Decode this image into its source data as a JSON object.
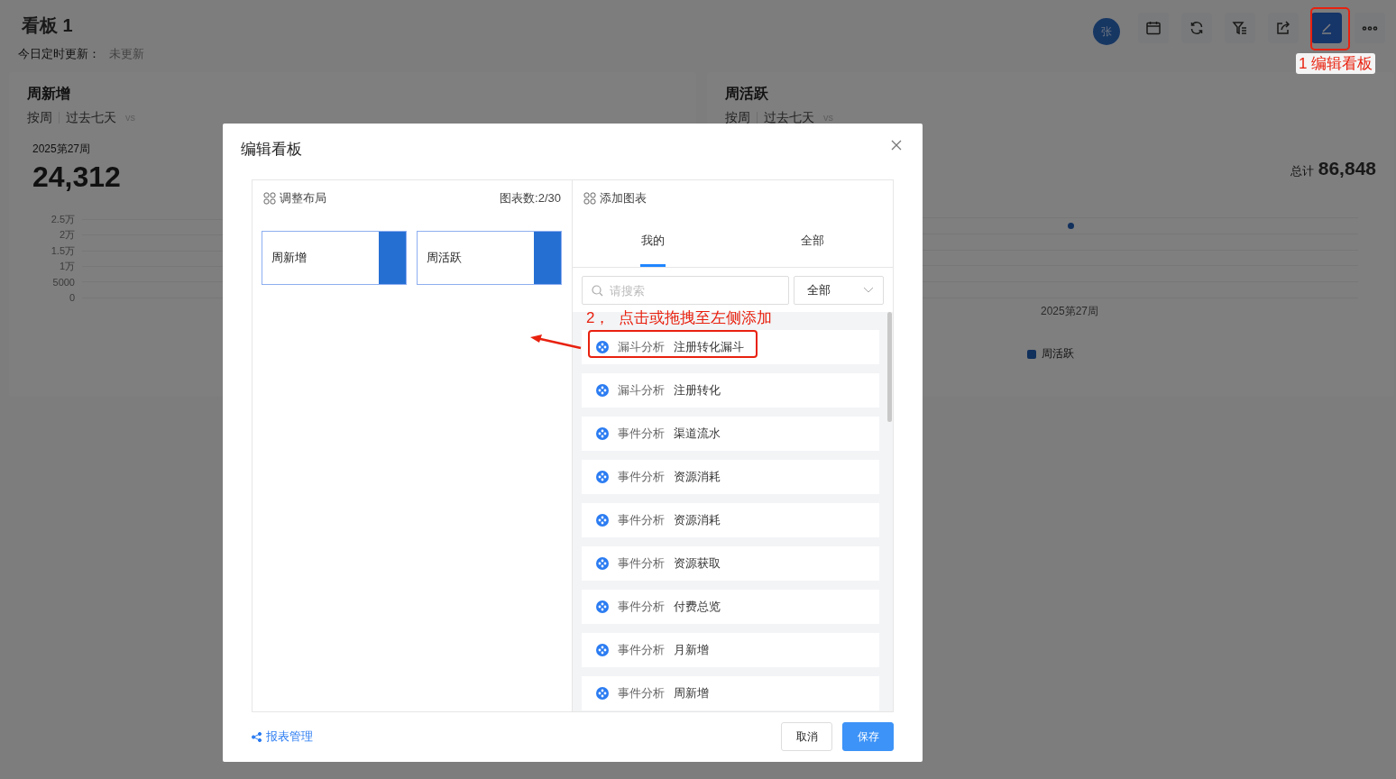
{
  "header": {
    "title": "看板 1",
    "update_label": "今日定时更新：",
    "update_value": "未更新"
  },
  "toolbar": {
    "avatar": "张",
    "note": "1 编辑看板",
    "buttons": [
      {
        "kind": "calendar",
        "selected": false
      },
      {
        "kind": "refresh",
        "selected": false
      },
      {
        "kind": "filter",
        "selected": false
      },
      {
        "kind": "share",
        "selected": false
      },
      {
        "kind": "edit",
        "selected": true
      },
      {
        "kind": "more",
        "selected": false
      }
    ]
  },
  "cards": [
    {
      "kind": "number",
      "title": "周新增",
      "period": "按周",
      "range": "过去七天",
      "vs": "vs",
      "week": "2025第27周",
      "value": "24,312",
      "y_ticks": [
        "2.5万",
        "2万",
        "1.5万",
        "1万",
        "5000",
        "0"
      ]
    },
    {
      "kind": "total",
      "title": "周活跃",
      "period": "按周",
      "range": "过去七天",
      "vs": "vs",
      "total_label": "总计",
      "total": "86,848",
      "x_label": "2025第27周",
      "legend": "周活跃"
    }
  ],
  "modal": {
    "title": "编辑看板",
    "layout": {
      "title": "调整布局",
      "count": "图表数:2/30",
      "charts": [
        "周新增",
        "周活跃"
      ]
    },
    "add": {
      "title": "添加图表",
      "tabs": [
        {
          "label": "我的",
          "selected": true
        },
        {
          "label": "全部",
          "selected": false
        }
      ],
      "search": {
        "placeholder": "请搜索"
      },
      "filter": "全部",
      "hint": "2，  点击或拖拽至左侧添加",
      "items": [
        {
          "type": "漏斗分析",
          "name": "注册转化漏斗",
          "highlighted": true
        },
        {
          "type": "漏斗分析",
          "name": "注册转化",
          "highlighted": false
        },
        {
          "type": "事件分析",
          "name": "渠道流水",
          "highlighted": false
        },
        {
          "type": "事件分析",
          "name": "资源消耗",
          "highlighted": false
        },
        {
          "type": "事件分析",
          "name": "资源消耗",
          "highlighted": false
        },
        {
          "type": "事件分析",
          "name": "资源获取",
          "highlighted": false
        },
        {
          "type": "事件分析",
          "name": "付费总览",
          "highlighted": false
        },
        {
          "type": "事件分析",
          "name": "月新增",
          "highlighted": false
        },
        {
          "type": "事件分析",
          "name": "周新增",
          "highlighted": false
        }
      ]
    },
    "footer": {
      "link": "报表管理",
      "buttons": [
        "取消",
        "保存"
      ]
    }
  }
}
